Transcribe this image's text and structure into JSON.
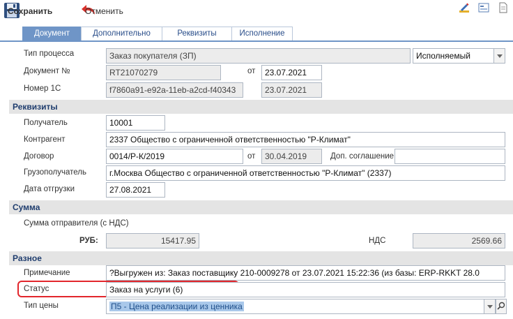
{
  "toolbar": {
    "save_label": "Сохранить",
    "cancel_label": "Отменить"
  },
  "tabs": [
    {
      "label": "Документ",
      "active": true
    },
    {
      "label": "Дополнительно",
      "active": false
    },
    {
      "label": "Реквизиты",
      "active": false
    },
    {
      "label": "Исполнение",
      "active": false
    }
  ],
  "main": {
    "process_type_label": "Тип процесса",
    "process_type_value": "Заказ покупателя (ЗП)",
    "process_mode_value": "Исполняемый",
    "doc_no_label": "Документ №",
    "doc_no_value": "RT21070279",
    "from_label": "от",
    "doc_date_value": "23.07.2021",
    "number_1c_label": "Номер 1С",
    "number_1c_value": "f7860a91-e92a-11eb-a2cd-f40343",
    "number_1c_date_value": "23.07.2021"
  },
  "requisites": {
    "title": "Реквизиты",
    "recipient_label": "Получатель",
    "recipient_value": "10001",
    "counterparty_label": "Контрагент",
    "counterparty_value": "2337 Общество с ограниченной ответственностью \"Р-Климат\"",
    "contract_label": "Договор",
    "contract_value": "0014/Р-К/2019",
    "from_label": "от",
    "contract_date_value": "30.04.2019",
    "add_agreement_label": "Доп. соглашение",
    "add_agreement_value": "",
    "consignee_label": "Грузополучатель",
    "consignee_value": "г.Москва Общество с ограниченной ответственностью \"Р-Климат\" (2337)",
    "ship_date_label": "Дата отгрузки",
    "ship_date_value": "27.08.2021"
  },
  "sum": {
    "title": "Сумма",
    "sender_sum_label": "Сумма отправителя (с НДС)",
    "rub_label": "РУБ:",
    "rub_value": "15417.95",
    "vat_label": "НДС",
    "vat_value": "2569.66"
  },
  "other": {
    "title": "Разное",
    "note_label": "Примечание",
    "note_value": "?Выгружен из: Заказ поставщику 210-0009278 от 23.07.2021 15:22:36 (из базы: ERP-RKKT 28.0",
    "status_label": "Статус",
    "status_value": "Заказ на услуги (6)",
    "price_type_label": "Тип цены",
    "price_type_value": "П5 - Цена реализации из ценника"
  },
  "colors": {
    "tab_active": "#6f95c7",
    "section_title": "#1f3d6e",
    "status_highlight": "#e2262c",
    "selection": "#a9c8ea"
  },
  "icons": [
    "floppy-disk-icon",
    "undo-arrow-icon",
    "edit-pencil-icon",
    "form-card-icon",
    "document-icon"
  ]
}
